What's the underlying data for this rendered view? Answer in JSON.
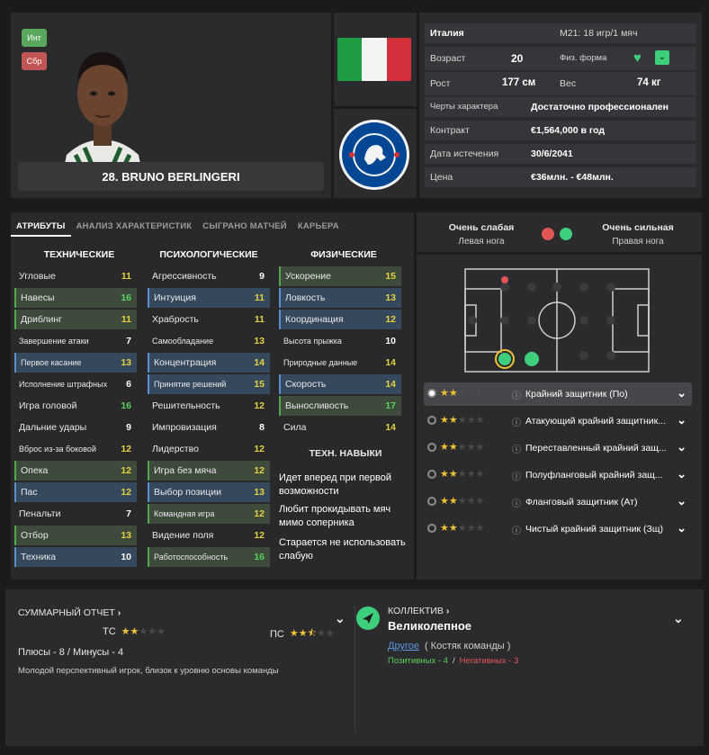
{
  "player": {
    "tag_int": "Инт",
    "tag_sbr": "Сбр",
    "name": "28. BRUNO BERLINGERI"
  },
  "info": {
    "country": "Италия",
    "youth": "M21: 18 игр/1 мяч",
    "age_label": "Возраст",
    "age": "20",
    "fitness_label": "Физ. форма",
    "height_label": "Рост",
    "height": "177 см",
    "weight_label": "Вес",
    "weight": "74 кг",
    "personality_label": "Черты характера",
    "personality": "Достаточно профессионален",
    "contract_label": "Контракт",
    "contract": "€1,564,000 в год",
    "expiry_label": "Дата истечения",
    "expiry": "30/6/2041",
    "value_label": "Цена",
    "value": "€36млн. - €48млн."
  },
  "tabs": [
    "АТРИБУТЫ",
    "АНАЛИЗ ХАРАКТЕРИСТИК",
    "СЫГРАНО МАТЧЕЙ",
    "КАРЬЕРА"
  ],
  "attributes": {
    "technical_header": "ТЕХНИЧЕСКИЕ",
    "mental_header": "ПСИХОЛОГИЧЕСКИЕ",
    "physical_header": "ФИЗИЧЕСКИЕ",
    "technical": [
      {
        "name": "Угловые",
        "value": "11",
        "hl": "plain"
      },
      {
        "name": "Навесы",
        "value": "16",
        "hl": "g"
      },
      {
        "name": "Дриблинг",
        "value": "11",
        "hl": "g"
      },
      {
        "name": "Завершение атаки",
        "value": "7",
        "hl": "plain",
        "small": true
      },
      {
        "name": "Первое касание",
        "value": "13",
        "hl": "b",
        "small": true
      },
      {
        "name": "Исполнение штрафных",
        "value": "6",
        "hl": "plain",
        "small": true
      },
      {
        "name": "Игра головой",
        "value": "16",
        "hl": "plain"
      },
      {
        "name": "Дальние удары",
        "value": "9",
        "hl": "plain"
      },
      {
        "name": "Вброс из-за боковой",
        "value": "12",
        "hl": "plain",
        "small": true
      },
      {
        "name": "Опека",
        "value": "12",
        "hl": "g"
      },
      {
        "name": "Пас",
        "value": "12",
        "hl": "b"
      },
      {
        "name": "Пенальти",
        "value": "7",
        "hl": "plain"
      },
      {
        "name": "Отбор",
        "value": "13",
        "hl": "g"
      },
      {
        "name": "Техника",
        "value": "10",
        "hl": "b"
      }
    ],
    "mental": [
      {
        "name": "Агрессивность",
        "value": "9",
        "hl": "plain"
      },
      {
        "name": "Интуиция",
        "value": "11",
        "hl": "b"
      },
      {
        "name": "Храбрость",
        "value": "11",
        "hl": "plain"
      },
      {
        "name": "Самообладание",
        "value": "13",
        "hl": "plain",
        "small": true
      },
      {
        "name": "Концентрация",
        "value": "14",
        "hl": "b"
      },
      {
        "name": "Принятие решений",
        "value": "15",
        "hl": "b",
        "small": true
      },
      {
        "name": "Решительность",
        "value": "12",
        "hl": "plain"
      },
      {
        "name": "Импровизация",
        "value": "8",
        "hl": "plain"
      },
      {
        "name": "Лидерство",
        "value": "12",
        "hl": "plain"
      },
      {
        "name": "Игра без мяча",
        "value": "12",
        "hl": "g"
      },
      {
        "name": "Выбор позиции",
        "value": "13",
        "hl": "b"
      },
      {
        "name": "Командная игра",
        "value": "12",
        "hl": "g",
        "small": true
      },
      {
        "name": "Видение поля",
        "value": "12",
        "hl": "plain"
      },
      {
        "name": "Работоспособность",
        "value": "16",
        "hl": "g",
        "small": true
      }
    ],
    "physical": [
      {
        "name": "Ускорение",
        "value": "15",
        "hl": "g"
      },
      {
        "name": "Ловкость",
        "value": "13",
        "hl": "b"
      },
      {
        "name": "Координация",
        "value": "12",
        "hl": "b"
      },
      {
        "name": "Высота прыжка",
        "value": "10",
        "hl": "plain",
        "small": true
      },
      {
        "name": "Природные данные",
        "value": "14",
        "hl": "plain",
        "small": true
      },
      {
        "name": "Скорость",
        "value": "14",
        "hl": "b"
      },
      {
        "name": "Выносливость",
        "value": "17",
        "hl": "g"
      },
      {
        "name": "Сила",
        "value": "14",
        "hl": "plain"
      }
    ],
    "skills_header": "ТЕХН. НАВЫКИ",
    "skills": [
      "Идет вперед при первой возможности",
      "Любит прокидывать мяч мимо соперника",
      "Старается не использовать слабую"
    ]
  },
  "feet": {
    "left_rating": "Очень слабая",
    "left_label": "Левая нога",
    "right_rating": "Очень сильная",
    "right_label": "Правая нога"
  },
  "positions": [
    {
      "name": "Крайний защитник (По)",
      "stars": 2,
      "selected": true
    },
    {
      "name": "Атакующий крайний защитник...",
      "stars": 2
    },
    {
      "name": "Переставленный крайний защ...",
      "stars": 2
    },
    {
      "name": "Полуфланговый крайний защ...",
      "stars": 2
    },
    {
      "name": "Фланговый защитник (Ат)",
      "stars": 2
    },
    {
      "name": "Чистый крайний защитник (Зщ)",
      "stars": 2
    }
  ],
  "summary": {
    "title": "СУММАРНЫЙ ОТЧЕТ",
    "tc_label": "ТС",
    "tc_stars": 2,
    "pc_label": "ПС",
    "pc_stars": 2.5,
    "pros_cons": "Плюсы - 8 / Минусы - 4",
    "description": "Молодой перспективный игрок, близок к уровню основы команды"
  },
  "team": {
    "title": "КОЛЛЕКТИВ",
    "value": "Великолепное",
    "friend": "Другое",
    "friend_note": "( Костяк команды )",
    "positive": "Позитивных - 4",
    "sep": "/",
    "negative": "Негативных - 3"
  },
  "colors": {
    "green": "#4fa84a",
    "blue": "#5b8fcf",
    "star": "#f1c232",
    "panel": "#2b2b2e"
  }
}
